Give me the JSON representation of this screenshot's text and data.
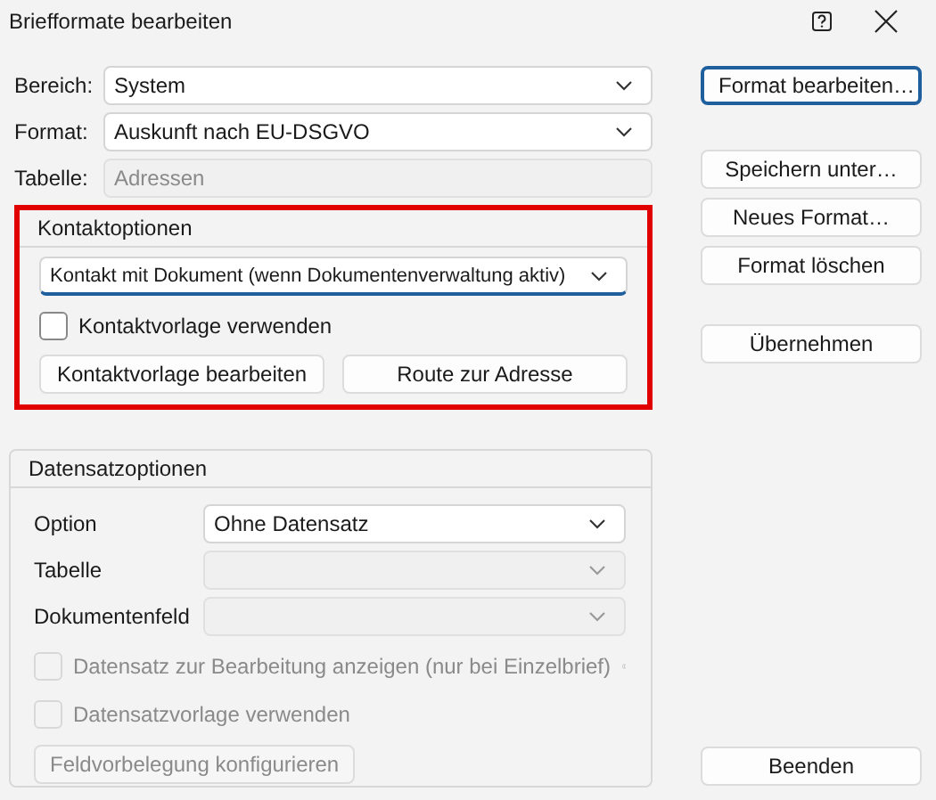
{
  "window": {
    "title": "Briefformate bearbeiten"
  },
  "fields": [
    {
      "label": "Bereich:",
      "value": "System",
      "kind": "combo",
      "disabled": false
    },
    {
      "label": "Format:",
      "value": "Auskunft nach EU-DSGVO",
      "kind": "combo",
      "disabled": false
    },
    {
      "label": "Tabelle:",
      "value": "Adressen",
      "kind": "text",
      "disabled": true
    }
  ],
  "contact_options": {
    "title": "Kontaktoptionen",
    "highlighted": true,
    "dropdown": {
      "value": "Kontakt mit Dokument (wenn Dokumentenverwaltung aktiv)",
      "focused": true
    },
    "checkbox": {
      "label": "Kontaktvorlage verwenden",
      "checked": false,
      "disabled": false
    },
    "buttons": [
      {
        "label": "Kontaktvorlage bearbeiten",
        "disabled": false
      },
      {
        "label": "Route zur Adresse",
        "disabled": false
      }
    ]
  },
  "record_options": {
    "title": "Datensatzoptionen",
    "fields": [
      {
        "label": "Option",
        "value": "Ohne Datensatz",
        "disabled": false
      },
      {
        "label": "Tabelle",
        "disabled": true
      },
      {
        "label": "Dokumentenfeld",
        "disabled": true
      }
    ],
    "checkboxes": [
      {
        "label": "Datensatz zur Bearbeitung anzeigen (nur bei Einzelbrief)",
        "checked": false,
        "disabled": true,
        "info": true
      },
      {
        "label": "Datensatzvorlage verwenden",
        "checked": false,
        "disabled": true,
        "info": false
      }
    ],
    "button": {
      "label": "Feldvorbelegung konfigurieren",
      "disabled": true
    }
  },
  "side_buttons": [
    [
      {
        "label": "Format bearbeiten…",
        "default": true
      }
    ],
    [
      {
        "label": "Speichern unter…",
        "default": false
      },
      {
        "label": "Neues Format…",
        "default": false
      },
      {
        "label": "Format löschen",
        "default": false
      }
    ],
    [
      {
        "label": "Übernehmen",
        "default": false
      }
    ]
  ],
  "close_button": {
    "label": "Beenden",
    "default": false
  }
}
